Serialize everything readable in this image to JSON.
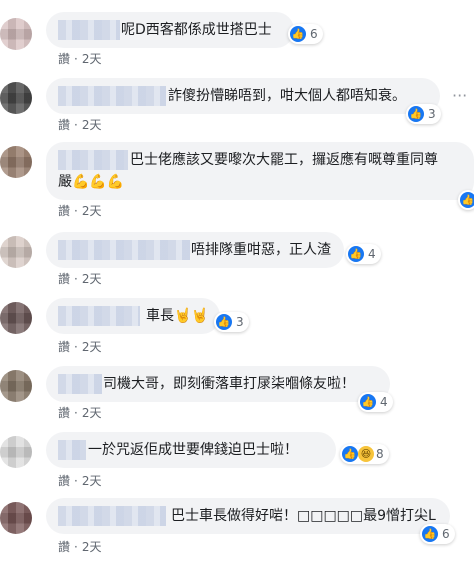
{
  "comments": [
    {
      "text": "呢D西客都係成世搭巴士",
      "likes": "6",
      "time": "2天",
      "like_label": "讚"
    },
    {
      "text": "詐傻扮懵睇唔到，咁大個人都唔知衰。",
      "likes": "3",
      "time": "2天",
      "like_label": "讚"
    },
    {
      "text_line1": "巴士佬應該又要嚟次大罷工，攞返應有嘅尊重同尊",
      "text_line2": "嚴💪💪💪",
      "time": "2天",
      "like_label": "讚"
    },
    {
      "text": "唔排隊重咁惡，正人渣",
      "likes": "4",
      "time": "2天",
      "like_label": "讚"
    },
    {
      "text": "車長🤘🤘",
      "likes": "3",
      "time": "2天",
      "like_label": "讚"
    },
    {
      "text": "司機大哥，即刻衝落車打㞗柒嗰條友啦！",
      "likes": "4",
      "time": "2天",
      "like_label": "讚"
    },
    {
      "text": "一於咒返佢成世要俾錢迫巴士啦！",
      "likes": "8",
      "time": "2天",
      "like_label": "讚"
    },
    {
      "text": "巴士車長做得好啱！□□□□□最9憎打尖L",
      "likes": "6",
      "time": "2天",
      "like_label": "讚"
    }
  ],
  "more_icon": "ellipsis-icon",
  "like_icon": "like-thumb-icon",
  "haha_icon": "haha-face-icon"
}
